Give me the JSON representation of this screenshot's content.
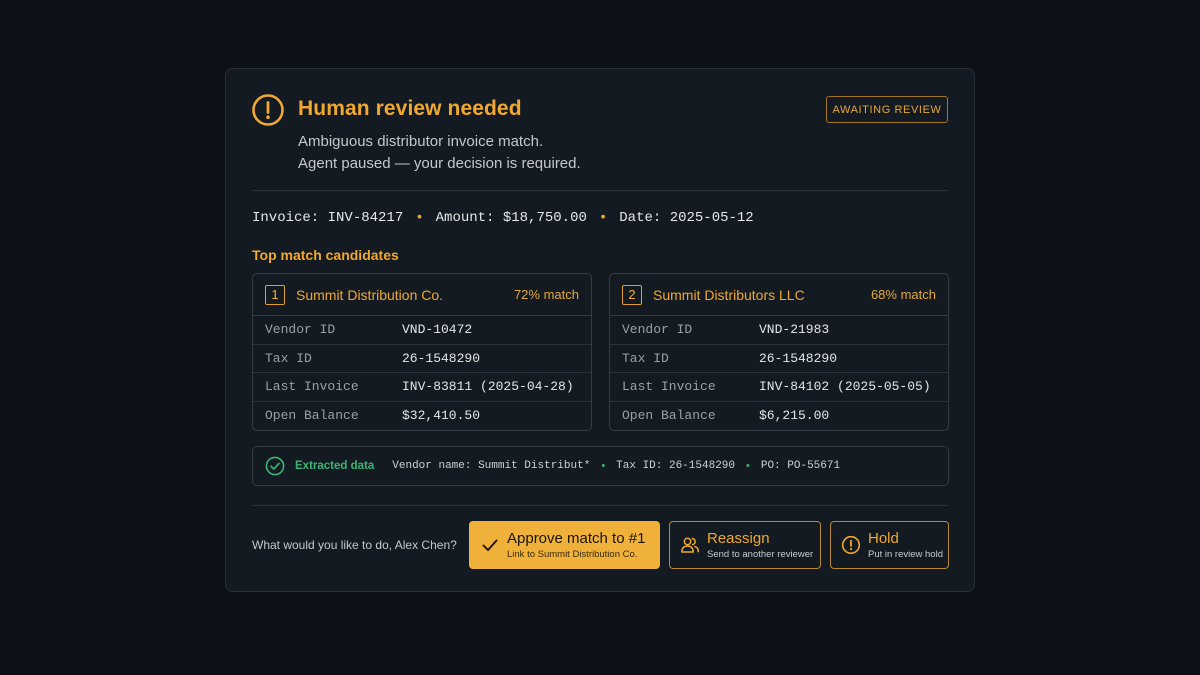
{
  "colors": {
    "accent": "#f0a830",
    "success": "#3bb573",
    "background": "#0d1117",
    "card": "#141a21"
  },
  "header": {
    "icon": "alert-circle-icon",
    "title": "Human review needed",
    "subtitle_line1": "Ambiguous distributor invoice match.",
    "subtitle_line2": "Agent paused — your decision is required.",
    "badge": "AWAITING REVIEW"
  },
  "invoice": {
    "invoice": "Invoice: INV-84217",
    "amount": "Amount: $18,750.00",
    "date": "Date: 2025-05-12",
    "separator": "•"
  },
  "candidates_title": "Top match candidates",
  "candidates": [
    {
      "number": "1",
      "name": "Summit Distribution Co.",
      "match": "72% match",
      "rows": [
        {
          "label": "Vendor ID",
          "value": "VND-10472"
        },
        {
          "label": "Tax ID",
          "value": "26-1548290"
        },
        {
          "label": "Last Invoice",
          "value": "INV-83811 (2025-04-28)"
        },
        {
          "label": "Open Balance",
          "value": "$32,410.50"
        }
      ]
    },
    {
      "number": "2",
      "name": "Summit Distributors LLC",
      "match": "68% match",
      "rows": [
        {
          "label": "Vendor ID",
          "value": "VND-21983"
        },
        {
          "label": "Tax ID",
          "value": "26-1548290"
        },
        {
          "label": "Last Invoice",
          "value": "INV-84102 (2025-05-05)"
        },
        {
          "label": "Open Balance",
          "value": "$6,215.00"
        }
      ]
    }
  ],
  "extracted": {
    "icon": "check-circle-icon",
    "label": "Extracted data",
    "vendor": "Vendor name: Summit Distribut*",
    "tax": "Tax ID: 26-1548290",
    "po": "PO: PO-55671",
    "separator": "•"
  },
  "actions": {
    "prompt": "What would you like to do, Alex Chen?",
    "approve": {
      "label": "Approve match to #1",
      "sub": "Link to Summit Distribution Co.",
      "icon": "checkmark-icon"
    },
    "reassign": {
      "label": "Reassign",
      "sub": "Send to another reviewer",
      "icon": "users-icon"
    },
    "hold": {
      "label": "Hold",
      "sub": "Put in review hold",
      "icon": "alert-circle-icon"
    }
  }
}
